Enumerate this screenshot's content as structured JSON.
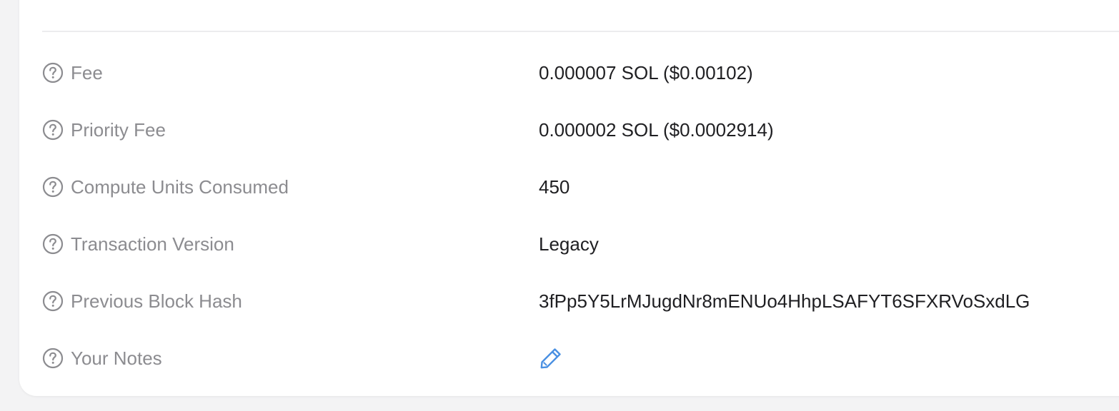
{
  "details": {
    "rows": [
      {
        "label": "Fee",
        "value": "0.000007 SOL ($0.00102)"
      },
      {
        "label": "Priority Fee",
        "value": "0.000002 SOL ($0.0002914)"
      },
      {
        "label": "Compute Units Consumed",
        "value": "450"
      },
      {
        "label": "Transaction Version",
        "value": "Legacy"
      },
      {
        "label": "Previous Block Hash",
        "value": "3fPp5Y5LrMJugdNr8mENUo4HhpLSAFYT6SFXRVoSxdLG"
      },
      {
        "label": "Your Notes",
        "value": ""
      }
    ],
    "help_icon": "question-circle-icon",
    "notes_icon": "pencil-icon"
  },
  "colors": {
    "label": "#8c8c90",
    "value": "#1f1f22",
    "accent": "#4a90e2",
    "background": "#f3f3f4",
    "card": "#ffffff"
  }
}
